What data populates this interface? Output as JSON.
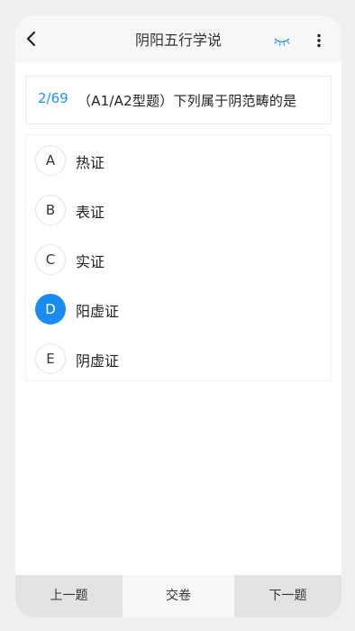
{
  "header": {
    "title": "阴阳五行学说",
    "icons": {
      "back": "chevron-left-icon",
      "eye": "closed-eye-icon",
      "more": "more-vertical-icon"
    },
    "accent_color": "#1e90ff"
  },
  "question": {
    "number": "2/69",
    "text": "（A1/A2型题）下列属于阴范畴的是"
  },
  "options": [
    {
      "letter": "A",
      "text": "热证",
      "selected": false
    },
    {
      "letter": "B",
      "text": "表证",
      "selected": false
    },
    {
      "letter": "C",
      "text": "实证",
      "selected": false
    },
    {
      "letter": "D",
      "text": "阳虚证",
      "selected": true
    },
    {
      "letter": "E",
      "text": "阴虚证",
      "selected": false
    }
  ],
  "footer": {
    "prev_label": "上一题",
    "submit_label": "交卷",
    "next_label": "下一题"
  }
}
